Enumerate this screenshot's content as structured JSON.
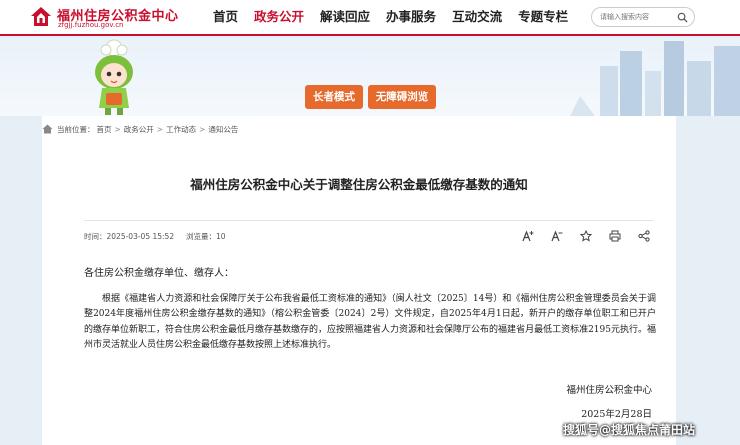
{
  "header": {
    "logo_title": "福州住房公积金中心",
    "logo_domain": "zfgjj.fuzhou.gov.cn",
    "nav": [
      "首页",
      "政务公开",
      "解读回应",
      "办事服务",
      "互动交流",
      "专题专栏"
    ],
    "active_nav": "政务公开",
    "search_placeholder": "请输入搜索内容"
  },
  "banner": {
    "elder_mode": "长者模式",
    "accessible": "无障碍浏览"
  },
  "breadcrumb": {
    "label": "当前位置：",
    "items": [
      "首页",
      "政务公开",
      "工作动态",
      "通知公告"
    ]
  },
  "article": {
    "title": "福州住房公积金中心关于调整住房公积金最低缴存基数的通知",
    "publish_label": "时间：",
    "publish_time": "2025-03-05 15:52",
    "views_label": "浏览量：",
    "views": "10",
    "tools": {
      "font_increase": "font-increase-icon",
      "font_decrease": "font-decrease-icon",
      "favorite": "star-icon",
      "print": "print-icon",
      "share": "share-icon"
    },
    "salutation": "各住房公积金缴存单位、缴存人：",
    "body": "根据《福建省人力资源和社会保障厅关于公布我省最低工资标准的通知》（闽人社文〔2025〕14号）和《福州住房公积金管理委员会关于调整2024年度福州住房公积金缴存基数的通知》（榕公积金管委〔2024〕2号）文件规定，自2025年4月1日起，新开户的缴存单位职工和已开户的缴存单位新职工，符合住房公积金最低月缴存基数缴存的，应按照福建省人力资源和社会保障厅公布的福建省月最低工资标准2195元执行。福州市灵活就业人员住房公积金最低缴存基数按照上述标准执行。",
    "signature_org": "福州住房公积金中心",
    "signature_date": "2025年2月28日"
  },
  "watermark": "搜狐号@搜狐焦点莆田站",
  "colors": {
    "brand": "#c8102e",
    "accent_button": "#e66a2c",
    "page_background": "#e6eef6"
  }
}
